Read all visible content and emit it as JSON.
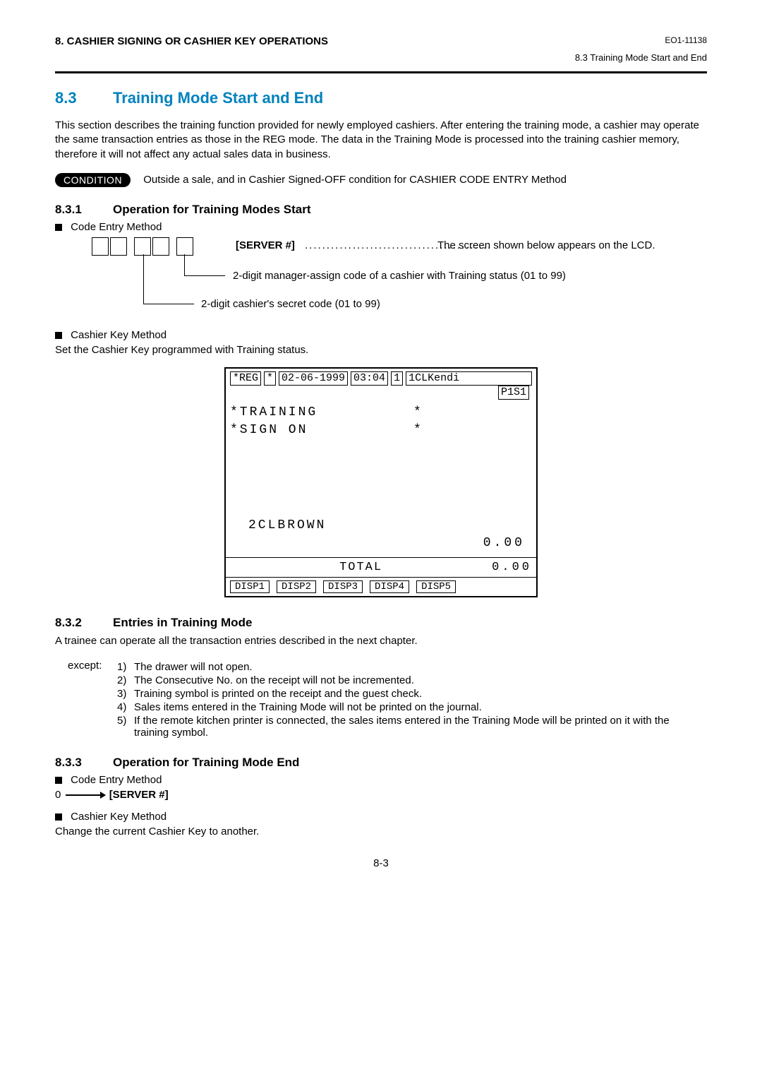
{
  "header": {
    "chapter": "8.  CASHIER SIGNING OR CASHIER KEY OPERATIONS",
    "doc_id": "EO1-11138",
    "sub": "8.3  Training Mode Start and End"
  },
  "section": {
    "num": "8.3",
    "title": "Training Mode Start and End",
    "para": "This section describes the training function provided for newly employed cashiers. After entering the training mode, a cashier may operate the same transaction entries as those in the REG mode. The data in the Training Mode is processed into the training cashier memory, therefore it will not affect any actual sales data in business."
  },
  "condition": {
    "label": "CONDITION",
    "text": "Outside a sale, and in Cashier Signed-OFF condition for CASHIER CODE ENTRY Method"
  },
  "sub1": {
    "num": "8.3.1",
    "title": "Operation for Training Modes Start",
    "code_entry_label": "Code Entry Method",
    "server_hash": "[SERVER #]",
    "dots": "...........................................",
    "lcd_note": "The screen shown below appears on the LCD.",
    "leg1": "2-digit manager-assign code of a cashier with Training status (01 to 99)",
    "leg2": "2-digit cashier's secret code (01 to 99)",
    "cashier_key_label": "Cashier Key Method",
    "cashier_key_text": "Set the Cashier Key programmed with Training status."
  },
  "lcd": {
    "status": {
      "reg": "*REG",
      "star": "*",
      "date": "02-06-1999",
      "time": "03:04",
      "one": "1",
      "clk": "1CLKendi"
    },
    "p1s1": "P1S1",
    "line1_left": "*TRAINING",
    "line1_right": "*",
    "line2_left": "*SIGN ON",
    "line2_right": "*",
    "name": "2CLBROWN",
    "amount": "0.00",
    "total_label": "TOTAL",
    "total_amount": "0.00",
    "disp": [
      "DISP1",
      "DISP2",
      "DISP3",
      "DISP4",
      "DISP5"
    ]
  },
  "sub2": {
    "num": "8.3.2",
    "title": "Entries in Training Mode",
    "para": "A trainee can operate all the transaction entries described in the next chapter.",
    "except_label": "except:",
    "items": [
      "The drawer will not open.",
      "The Consecutive No. on the receipt will not be incremented.",
      "Training symbol is printed on the receipt and the guest check.",
      "Sales items entered in the Training Mode will not be printed on the journal.",
      "If the remote kitchen printer is connected, the sales items entered in the Training Mode will be printed on it with the training symbol."
    ]
  },
  "sub3": {
    "num": "8.3.3",
    "title": "Operation for Training Mode End",
    "code_entry_label": "Code Entry Method",
    "zero": "0",
    "server_hash": "[SERVER #]",
    "cashier_key_label": "Cashier Key Method",
    "cashier_key_text": "Change the current Cashier Key to another."
  },
  "page_num": "8-3"
}
